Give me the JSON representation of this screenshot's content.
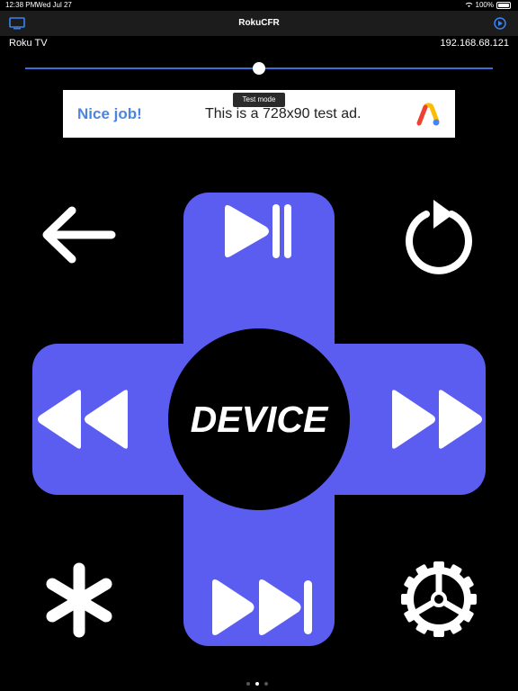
{
  "status_bar": {
    "time": "12:38 PM",
    "date": "Wed Jul 27",
    "battery": "100%"
  },
  "navbar": {
    "title": "RokuCFR",
    "left_icon": "cast-icon",
    "right_icon": "connect-icon"
  },
  "device": {
    "name": "Roku TV",
    "ip": "192.168.68.121"
  },
  "slider": {
    "value": 0.5,
    "track_color": "#3b6fd6"
  },
  "tooltip": {
    "text": "Test mode"
  },
  "ad": {
    "headline": "Nice job!",
    "body": "This is a 728x90 test ad.",
    "headline_color": "#4a86e0"
  },
  "remote": {
    "accent_color": "#5b5df1",
    "center_label": "DEVICE",
    "buttons": [
      "back-icon",
      "play-pause-icon",
      "replay-icon",
      "rewind-icon",
      "fast-forward-icon",
      "asterisk-icon",
      "skip-icon",
      "settings-gear-icon"
    ]
  },
  "pager": {
    "count": 3,
    "active": 1
  }
}
